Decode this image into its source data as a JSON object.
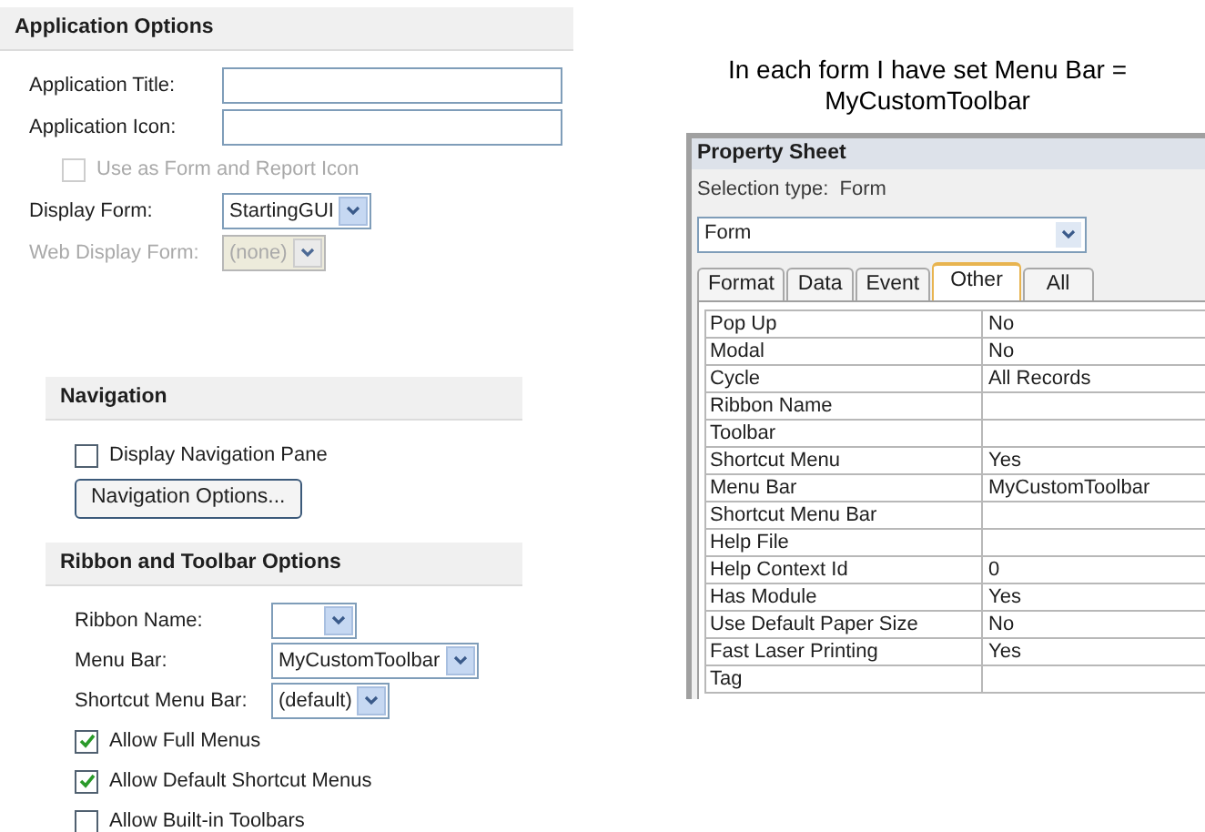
{
  "application_options": {
    "title": "Application Options",
    "items": [
      {
        "kind": "text_field",
        "label": "Application Title:"
      },
      {
        "kind": "text_field",
        "label": "Application Icon:"
      },
      {
        "kind": "checkbox",
        "label": "Use as Form and Report Icon",
        "checked": false,
        "disabled": true
      },
      {
        "kind": "dropdown",
        "label": "Display Form:",
        "value": "StartingGUI",
        "disabled": false
      },
      {
        "kind": "dropdown",
        "label": "Web Display Form:",
        "value": "(none)",
        "disabled": true
      }
    ]
  },
  "navigation": {
    "title": "Navigation",
    "items": [
      {
        "kind": "checkbox",
        "label": "Display Navigation Pane",
        "checked": false,
        "disabled": false
      },
      {
        "kind": "button",
        "label": "Navigation Options..."
      }
    ]
  },
  "ribbon_and_toolbar_options": {
    "title": "Ribbon and Toolbar Options",
    "items": [
      {
        "kind": "dropdown",
        "label": "Ribbon Name:",
        "disabled": false
      },
      {
        "kind": "dropdown",
        "label": "Menu Bar:",
        "value": "MyCustomToolbar",
        "disabled": false
      },
      {
        "kind": "dropdown",
        "label": "Shortcut Menu Bar:",
        "value": "(default)",
        "disabled": false
      },
      {
        "kind": "checkbox",
        "label": "Allow Full Menus",
        "checked": true,
        "disabled": false
      },
      {
        "kind": "checkbox",
        "label": "Allow Default Shortcut Menus",
        "checked": true,
        "disabled": false
      },
      {
        "kind": "checkbox",
        "label": "Allow Built-in Toolbars",
        "checked": false,
        "disabled": false
      }
    ]
  },
  "caption": [
    "In each form I have set Menu Bar =",
    "MyCustomToolbar"
  ],
  "property_sheet": {
    "title": "Property Sheet",
    "selection_type": "Selection type:  Form",
    "object_selector": "Form",
    "tabs": [
      {
        "label": "Format",
        "selected": false
      },
      {
        "label": "Data",
        "selected": false
      },
      {
        "label": "Event",
        "selected": false
      },
      {
        "label": "Other",
        "selected": true
      },
      {
        "label": "All",
        "selected": false
      }
    ],
    "properties": [
      {
        "name": "Pop Up",
        "value": "No"
      },
      {
        "name": "Modal",
        "value": "No"
      },
      {
        "name": "Cycle",
        "value": "All Records"
      },
      {
        "name": "Ribbon Name"
      },
      {
        "name": "Toolbar"
      },
      {
        "name": "Shortcut Menu",
        "value": "Yes"
      },
      {
        "name": "Menu Bar",
        "value": "MyCustomToolbar"
      },
      {
        "name": "Shortcut Menu Bar"
      },
      {
        "name": "Help File"
      },
      {
        "name": "Help Context Id",
        "value": "0"
      },
      {
        "name": "Has Module",
        "value": "Yes"
      },
      {
        "name": "Use Default Paper Size",
        "value": "No"
      },
      {
        "name": "Fast Laser Printing",
        "value": "Yes"
      },
      {
        "name": "Tag"
      }
    ]
  }
}
